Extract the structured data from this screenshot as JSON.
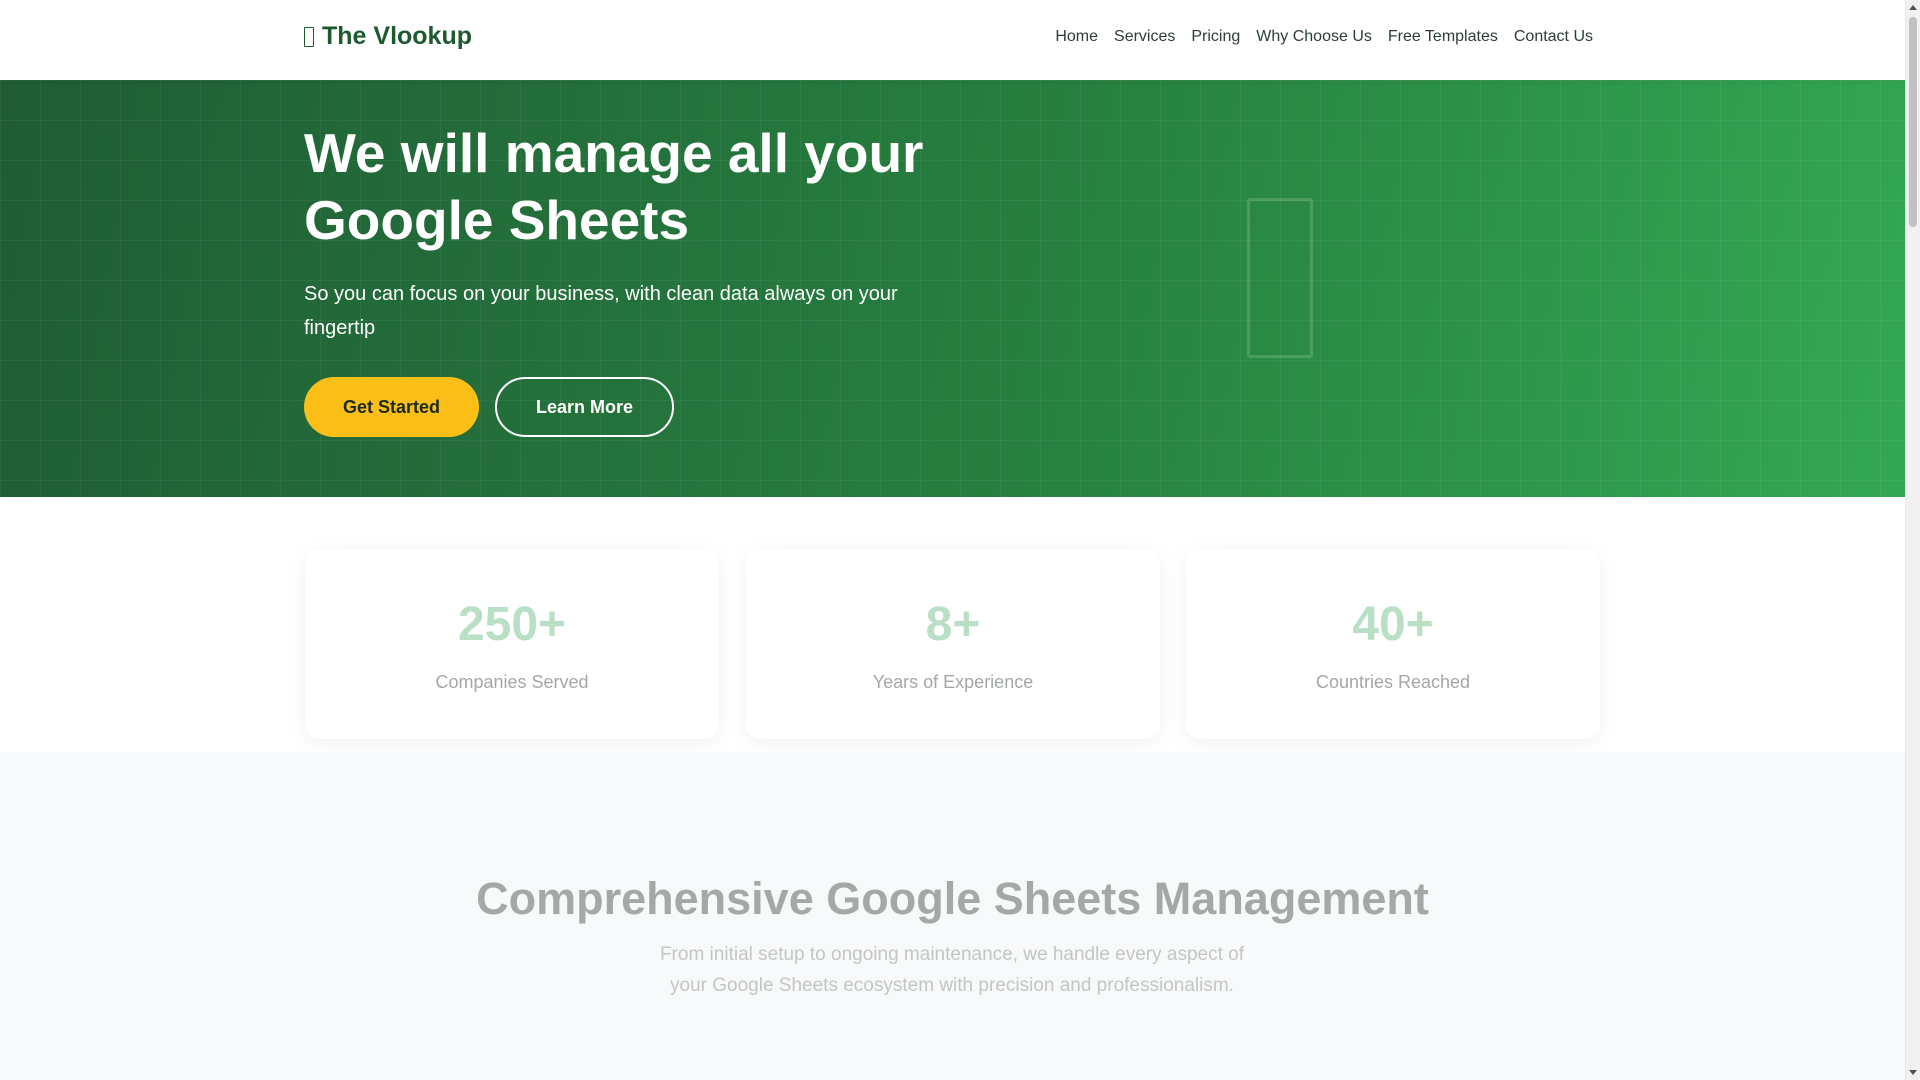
{
  "navbar": {
    "brand": "The Vlookup",
    "brand_icon": "spreadsheet-icon",
    "links": [
      {
        "label": "Home"
      },
      {
        "label": "Services"
      },
      {
        "label": "Pricing"
      },
      {
        "label": "Why Choose Us"
      },
      {
        "label": "Free Templates"
      },
      {
        "label": "Contact Us"
      }
    ]
  },
  "hero": {
    "title": "We will manage all your Google Sheets",
    "subtitle": "So you can focus on your business, with clean data always on your fingertip",
    "primary_button": "Get Started",
    "secondary_button": "Learn More",
    "illustration_icon": "spreadsheet-icon"
  },
  "stats": [
    {
      "value": "250+",
      "label": "Companies Served"
    },
    {
      "value": "8+",
      "label": "Years of Experience"
    },
    {
      "value": "40+",
      "label": "Countries Reached"
    }
  ],
  "services": {
    "title": "Comprehensive Google Sheets Management",
    "description": "From initial setup to ongoing maintenance, we handle every aspect of your Google Sheets ecosystem with precision and professionalism."
  },
  "colors": {
    "brand_green": "#1d5a30",
    "hero_gradient_start": "#1f5c35",
    "hero_gradient_end": "#33a853",
    "accent_yellow": "#fbbf17"
  }
}
